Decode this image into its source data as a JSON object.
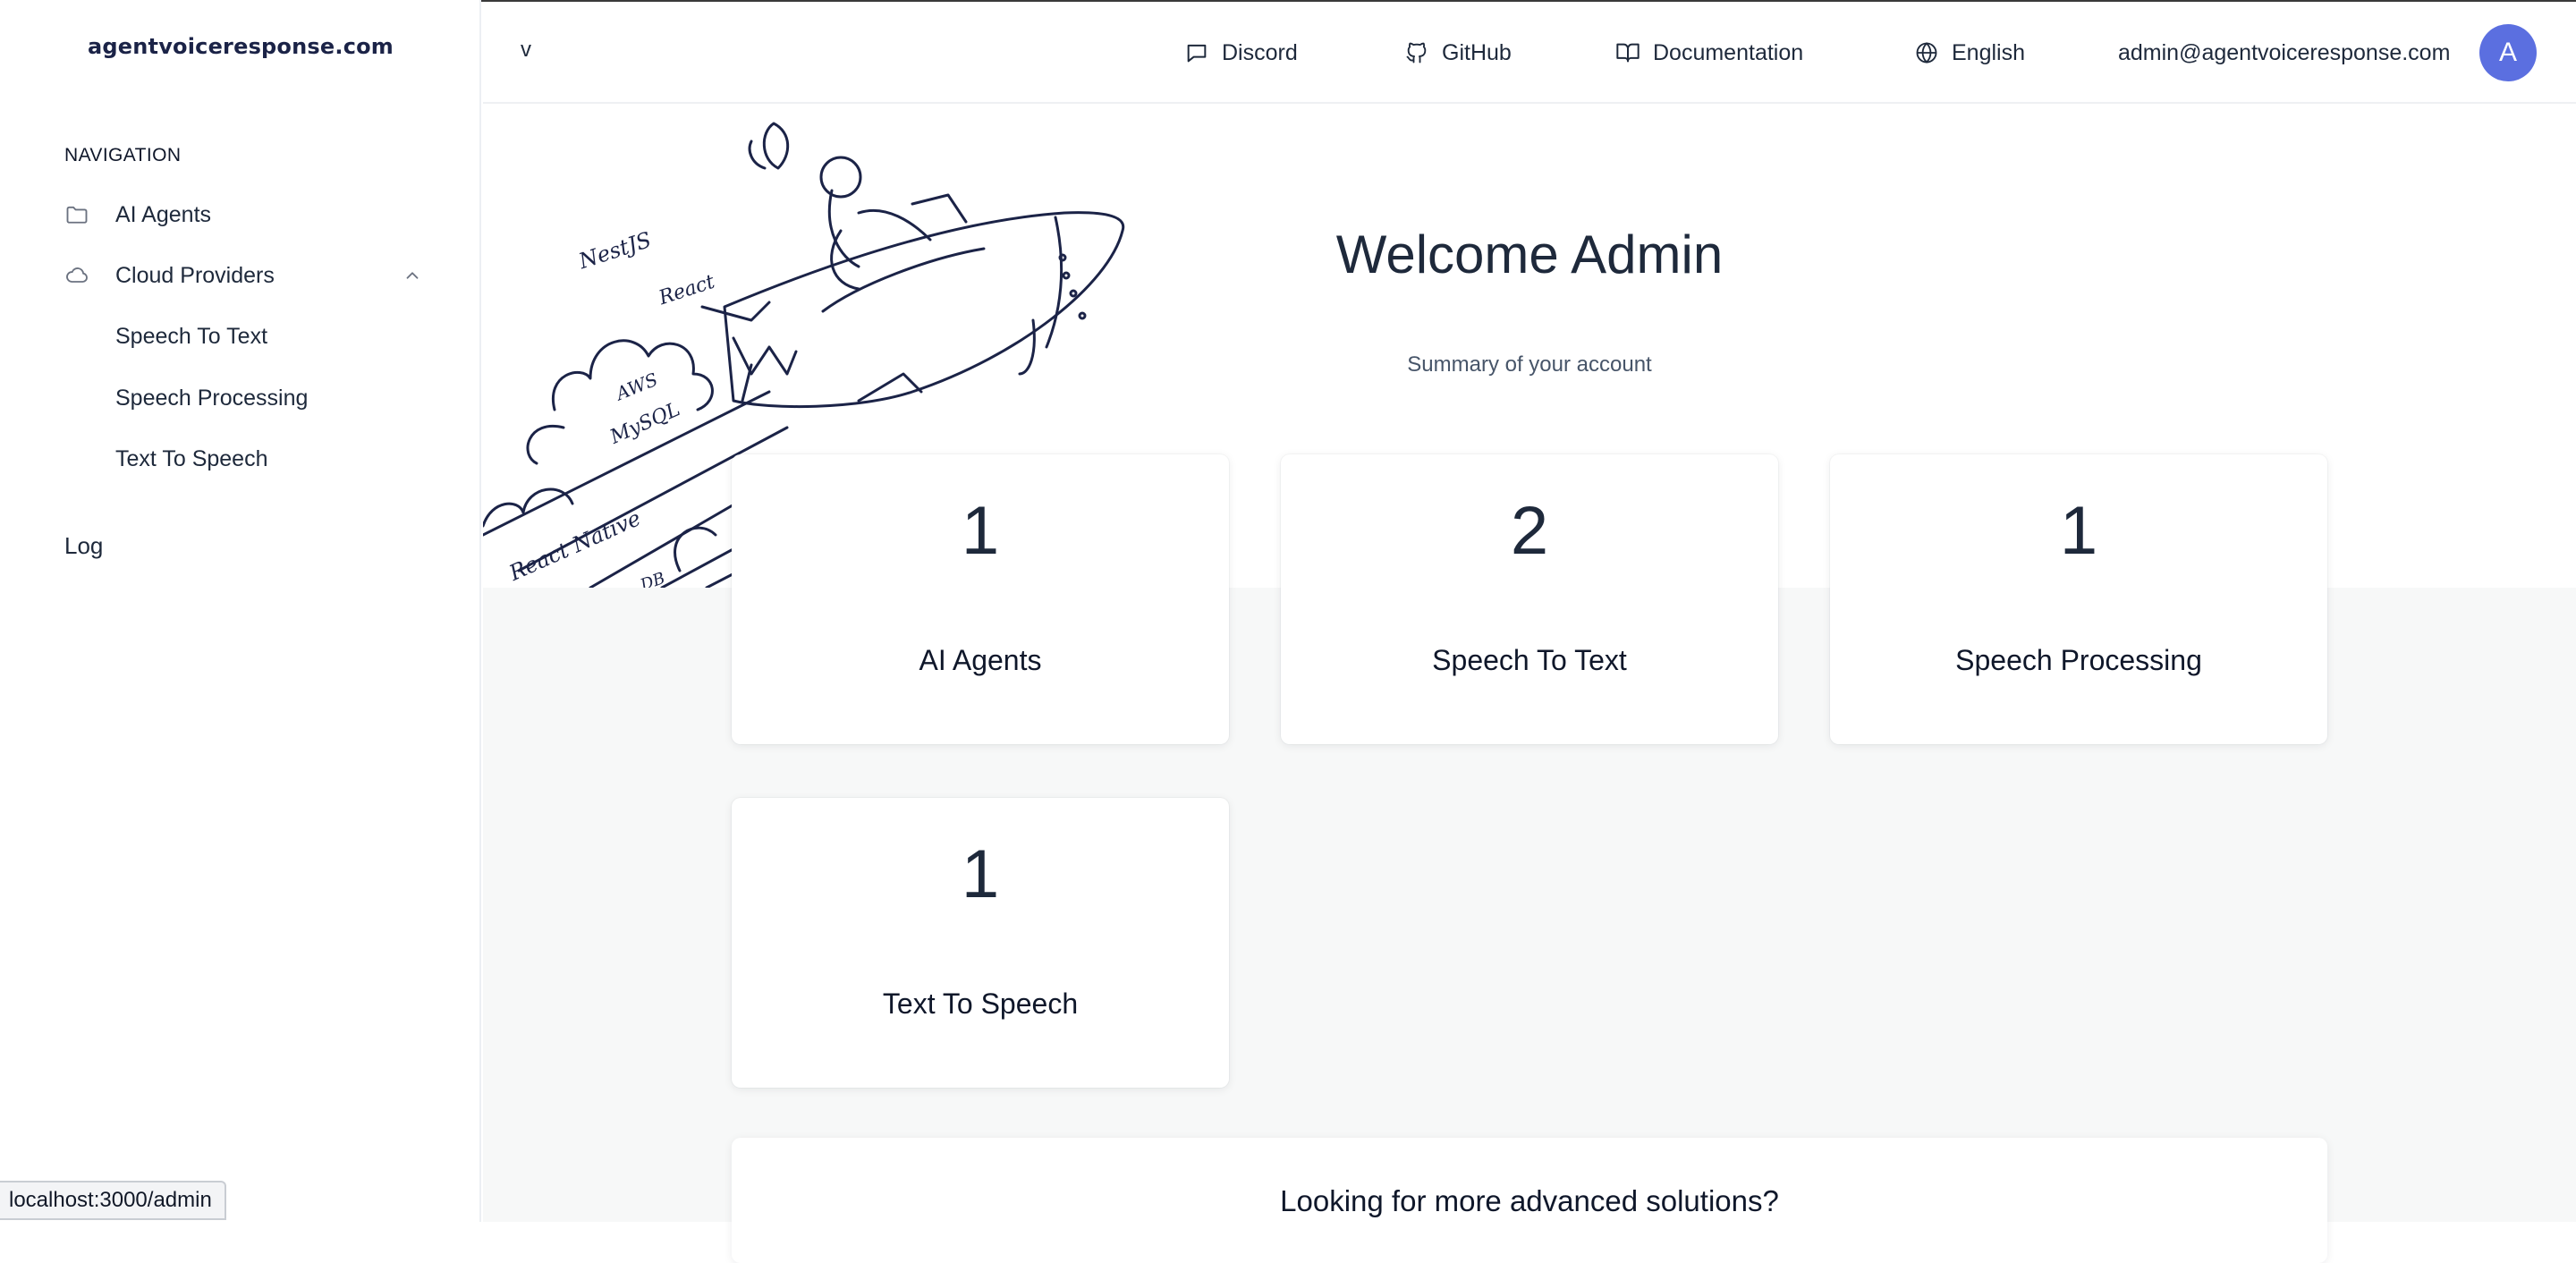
{
  "brand": "agentvoiceresponse.com",
  "sidebar": {
    "heading": "NAVIGATION",
    "items": [
      {
        "label": "AI Agents",
        "icon": "folder-icon"
      },
      {
        "label": "Cloud Providers",
        "icon": "cloud-icon",
        "expanded": true
      }
    ],
    "subitems": [
      {
        "label": "Speech To Text"
      },
      {
        "label": "Speech Processing"
      },
      {
        "label": "Text To Speech"
      }
    ],
    "log_label": "Log"
  },
  "header": {
    "menu_toggle": "v",
    "links": [
      {
        "label": "Discord",
        "icon": "message-square-icon"
      },
      {
        "label": "GitHub",
        "icon": "github-icon"
      },
      {
        "label": "Documentation",
        "icon": "book-open-icon"
      },
      {
        "label": "English",
        "icon": "globe-icon"
      }
    ],
    "user_email": "admin@agentvoiceresponse.com",
    "avatar_initial": "A",
    "avatar_color": "#5b6fe0"
  },
  "illustration": {
    "labels": [
      "NestJS",
      "React",
      "AWS",
      "MySQL",
      "React Native",
      "DB"
    ]
  },
  "main": {
    "welcome": "Welcome Admin",
    "summary": "Summary of your account",
    "cards": [
      {
        "value": "1",
        "label": "AI Agents"
      },
      {
        "value": "2",
        "label": "Speech To Text"
      },
      {
        "value": "1",
        "label": "Speech Processing"
      },
      {
        "value": "1",
        "label": "Text To Speech"
      }
    ],
    "promo_title": "Looking for more advanced solutions?"
  },
  "status_url": "localhost:3000/admin"
}
